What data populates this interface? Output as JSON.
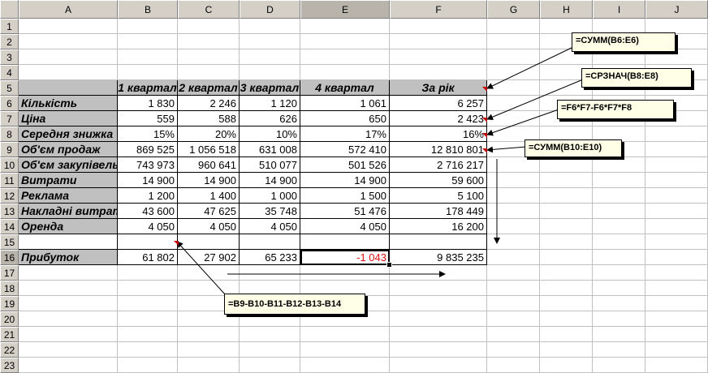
{
  "columns": [
    "A",
    "B",
    "C",
    "D",
    "E",
    "F",
    "G",
    "H",
    "I",
    "J"
  ],
  "rows": [
    "1",
    "2",
    "3",
    "4",
    "5",
    "6",
    "7",
    "8",
    "9",
    "10",
    "11",
    "12",
    "13",
    "14",
    "15",
    "16",
    "17",
    "18",
    "19",
    "20",
    "21",
    "22",
    "23"
  ],
  "table": {
    "headers": [
      "1 квартал",
      "2 квартал",
      "3 квартал",
      "4 квартал",
      "За рік"
    ],
    "data_rows": [
      {
        "label": "Кількість",
        "values": [
          "1 830",
          "2 246",
          "1 120",
          "1 061",
          "6 257"
        ]
      },
      {
        "label": "Ціна",
        "values": [
          "559",
          "588",
          "626",
          "650",
          "2 423"
        ]
      },
      {
        "label": "Середня знижка",
        "values": [
          "15%",
          "20%",
          "10%",
          "17%",
          "16%"
        ]
      },
      {
        "label": "Об'єм продаж",
        "values": [
          "869 525",
          "1 056 518",
          "631 008",
          "572 410",
          "12 810 801"
        ]
      },
      {
        "label": "Об'єм закупівель",
        "values": [
          "743 973",
          "960 641",
          "510 077",
          "501 526",
          "2 716 217"
        ]
      },
      {
        "label": "Витрати",
        "values": [
          "14 900",
          "14 900",
          "14 900",
          "14 900",
          "59 600"
        ]
      },
      {
        "label": "Реклама",
        "values": [
          "1 200",
          "1 400",
          "1 000",
          "1 500",
          "5 100"
        ]
      },
      {
        "label": "Накладні витрати",
        "values": [
          "43 600",
          "47 625",
          "35 748",
          "51 476",
          "178 449"
        ]
      },
      {
        "label": "Оренда",
        "values": [
          "4 050",
          "4 050",
          "4 050",
          "4 050",
          "16 200"
        ]
      }
    ],
    "profit": {
      "label": "Прибуток",
      "values": [
        "61 802",
        "27 902",
        "65 233",
        "-1 043",
        "9 835 235"
      ]
    }
  },
  "callouts": {
    "sum_b6_e6": "=СУММ(B6:E6)",
    "avg_b8_e8": "=СРЗНАЧ(B8:E8)",
    "f6_formula": "=F6*F7-F6*F7*F8",
    "sum_b10_e10": "=СУММ(B10:E10)",
    "profit_formula": "=B9-B10-B11-B12-B13-B14"
  },
  "colors": {
    "header_bg": "#d4d0c8",
    "label_bg": "#c0c0c0",
    "negative": "#e01010",
    "callout_bg": "#ffffe8"
  }
}
